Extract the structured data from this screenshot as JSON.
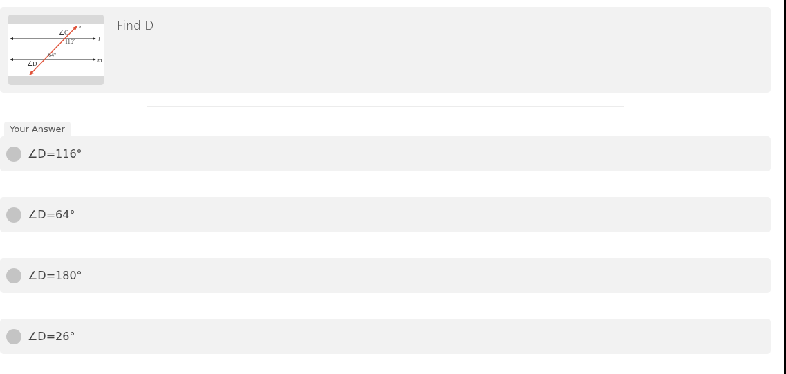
{
  "question": {
    "figure": {
      "labels": [
        {
          "kind": "angle",
          "text": "∠C"
        },
        {
          "kind": "angle",
          "text": "116°"
        },
        {
          "kind": "angle",
          "text": "64°"
        },
        {
          "kind": "angle",
          "text": "∠D"
        },
        {
          "kind": "line",
          "text": "n"
        },
        {
          "kind": "line",
          "text": "l"
        },
        {
          "kind": "line",
          "text": "m"
        }
      ]
    },
    "text": "Find D"
  },
  "answer_label": "Your Answer",
  "options": [
    {
      "label": "∠D=116°",
      "selected": false
    },
    {
      "label": "∠D=64°",
      "selected": false
    },
    {
      "label": "∠D=180°",
      "selected": false
    },
    {
      "label": "∠D=26°",
      "selected": false
    }
  ]
}
